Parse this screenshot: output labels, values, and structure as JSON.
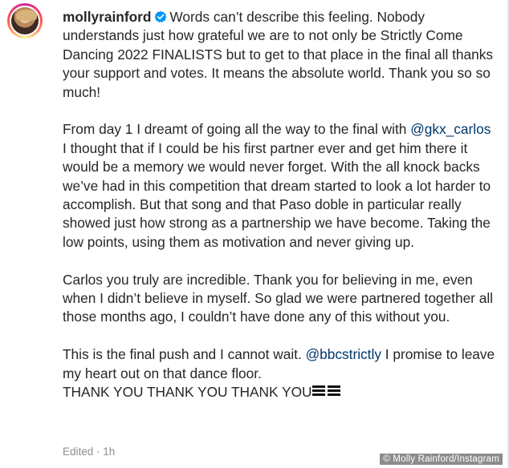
{
  "post": {
    "username": "mollyrainford",
    "verified_icon": "verified-badge-icon",
    "p1": "Words can’t describe this feeling. Nobody understands just how grateful we are to not only be Strictly Come Dancing 2022 FINALISTS but to get to that place in the final all thanks your support and votes. It means the absolute world. Thank you so so much!",
    "p2_start": "From day 1 I dreamt of going all the way to the final with",
    "p2_mention": "@gkx_carlos",
    "p2_rest": " I thought that if I could be his first partner ever and get him there it would be a memory we would never forget. With the all knock backs we’ve had in this competition that dream started to look a lot harder to accomplish. But that song and that Paso doble in particular really showed just how strong as a partnership we have become. Taking the low points, using them as motivation and never giving up.",
    "p3": "Carlos you truly are incredible. Thank you for believing in me, even when I didn’t believe in myself. So glad we were partnered together all those months ago, I couldn’t have done any of this without you.",
    "p4_start": "This is the final push and I cannot wait. ",
    "p4_mention": "@bbcstrictly",
    "p4_rest": " I promise to leave my heart out on that dance floor.",
    "p4_thanks": "THANK YOU THANK YOU THANK YOU",
    "emoji_icon": "sparkle-stack-emoji",
    "meta": "Edited · 1h"
  },
  "credit": "© Molly Rainford/Instagram",
  "colors": {
    "text": "#262626",
    "mention": "#00376b",
    "verified": "#0095f6",
    "meta": "#8e8e8e"
  }
}
